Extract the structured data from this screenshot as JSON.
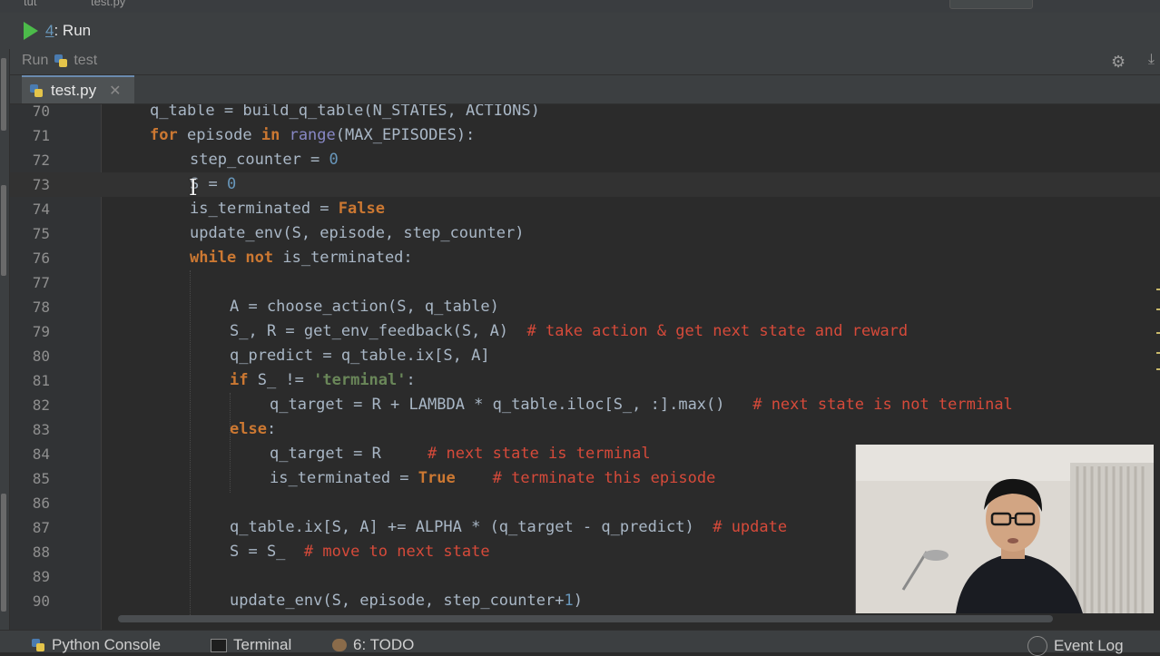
{
  "topbar": {
    "crumb_left": "tut",
    "crumb_file": "test.py",
    "run_config": "test"
  },
  "run_tool": {
    "tab_number": "4",
    "tab_label": ": Run",
    "header_label": "Run",
    "config_name": "test"
  },
  "file_tabs": [
    {
      "name": "test.py",
      "active": true
    }
  ],
  "editor": {
    "lines": [
      {
        "n": "70",
        "text": "q_table = build_q_table(N_STATES, ACTIONS)"
      },
      {
        "n": "71",
        "text": "for episode in range(MAX_EPISODES):"
      },
      {
        "n": "72",
        "text": "step_counter = 0"
      },
      {
        "n": "73",
        "text": "S = 0"
      },
      {
        "n": "74",
        "text": "is_terminated = False"
      },
      {
        "n": "75",
        "text": "update_env(S, episode, step_counter)"
      },
      {
        "n": "76",
        "text": "while not is_terminated:"
      },
      {
        "n": "77",
        "text": ""
      },
      {
        "n": "78",
        "text": "A = choose_action(S, q_table)"
      },
      {
        "n": "79",
        "text": "S_, R = get_env_feedback(S, A)  # take action & get next state and reward"
      },
      {
        "n": "80",
        "text": "q_predict = q_table.ix[S, A]"
      },
      {
        "n": "81",
        "text": "if S_ != 'terminal':"
      },
      {
        "n": "82",
        "text": "q_target = R + LAMBDA * q_table.iloc[S_, :].max()   # next state is not terminal"
      },
      {
        "n": "83",
        "text": "else:"
      },
      {
        "n": "84",
        "text": "q_target = R     # next state is terminal"
      },
      {
        "n": "85",
        "text": "is_terminated = True    # terminate this episode"
      },
      {
        "n": "86",
        "text": ""
      },
      {
        "n": "87",
        "text": "q_table.ix[S, A] += ALPHA * (q_target - q_predict)  # update"
      },
      {
        "n": "88",
        "text": "S = S_  # move to next state"
      },
      {
        "n": "89",
        "text": ""
      },
      {
        "n": "90",
        "text": "update_env(S, episode, step_counter+1)"
      }
    ]
  },
  "bottom_tabs": {
    "python_console": "Python Console",
    "terminal": "Terminal",
    "todo": "6: TODO",
    "event_log": "Event Log"
  },
  "icons": {
    "run": "play-icon",
    "python_file": "python-file-icon",
    "settings": "gear-icon",
    "close": "close-icon",
    "download": "download-icon",
    "cursor": "text-cursor-icon"
  },
  "colors": {
    "keyword": "#cc7832",
    "number": "#6897bb",
    "string": "#6a8759",
    "builtin": "#8888c6",
    "comment": "#d64a3a",
    "run_green": "#4cbb4a"
  }
}
